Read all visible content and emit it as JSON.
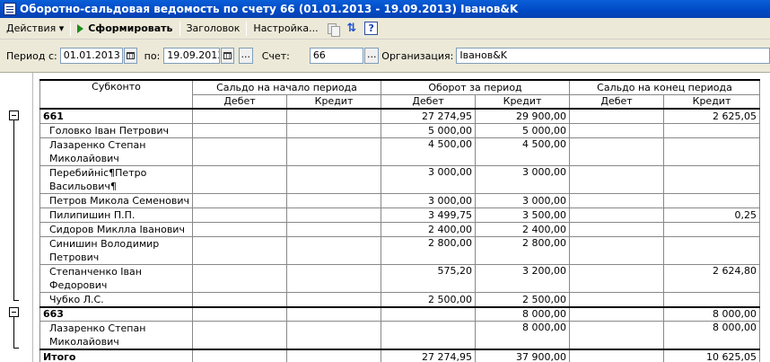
{
  "window": {
    "title": "Оборотно-сальдовая ведомость по счету 66 (01.01.2013 - 19.09.2013) Іванов&K"
  },
  "toolbar": {
    "actions_label": "Действия ▾",
    "generate_label": "Сформировать",
    "header_label": "Заголовок",
    "settings_label": "Настройка...",
    "help_label": "?"
  },
  "filter": {
    "period_from_label": "Период с:",
    "period_from_value": "01.01.2013",
    "period_to_label": "по:",
    "period_to_value": "19.09.2013",
    "account_label": "Счет:",
    "account_value": "66",
    "org_label": "Организация:",
    "org_value": "Іванов&K",
    "dots": "..."
  },
  "report": {
    "headers": {
      "subconto": "Субконто",
      "opening": "Сальдо на начало периода",
      "turnover": "Оборот за период",
      "closing": "Сальдо на конец периода",
      "debit": "Дебет",
      "credit": "Кредит"
    },
    "rows": [
      {
        "type": "group",
        "name": "661",
        "od": "",
        "oc": "",
        "td": "27 274,95",
        "tc": "29 900,00",
        "cd": "",
        "cc": "2 625,05"
      },
      {
        "type": "item",
        "name": "Головко  Іван Петрович",
        "od": "",
        "oc": "",
        "td": "5 000,00",
        "tc": "5 000,00",
        "cd": "",
        "cc": ""
      },
      {
        "type": "item2",
        "name": "Лазаренко Степан Миколайович",
        "od": "",
        "oc": "",
        "td": "4 500,00",
        "tc": "4 500,00",
        "cd": "",
        "cc": ""
      },
      {
        "type": "item2",
        "name": "Перебийніс¶Петро Васильович¶",
        "od": "",
        "oc": "",
        "td": "3 000,00",
        "tc": "3 000,00",
        "cd": "",
        "cc": ""
      },
      {
        "type": "item",
        "name": "Петров Микола Семенович",
        "od": "",
        "oc": "",
        "td": "3 000,00",
        "tc": "3 000,00",
        "cd": "",
        "cc": ""
      },
      {
        "type": "item",
        "name": "Пилипишин П.П.",
        "od": "",
        "oc": "",
        "td": "3 499,75",
        "tc": "3 500,00",
        "cd": "",
        "cc": "0,25"
      },
      {
        "type": "item",
        "name": "Сидоров Миклла Іванович",
        "od": "",
        "oc": "",
        "td": "2 400,00",
        "tc": "2 400,00",
        "cd": "",
        "cc": ""
      },
      {
        "type": "item2",
        "name": "Синишин Володимир Петрович",
        "od": "",
        "oc": "",
        "td": "2 800,00",
        "tc": "2 800,00",
        "cd": "",
        "cc": ""
      },
      {
        "type": "item2",
        "name": "Степанченко Іван Федорович",
        "od": "",
        "oc": "",
        "td": "575,20",
        "tc": "3 200,00",
        "cd": "",
        "cc": "2 624,80"
      },
      {
        "type": "item",
        "name": "Чубко Л.С.",
        "od": "",
        "oc": "",
        "td": "2 500,00",
        "tc": "2 500,00",
        "cd": "",
        "cc": ""
      },
      {
        "type": "group",
        "name": "663",
        "od": "",
        "oc": "",
        "td": "",
        "tc": "8 000,00",
        "cd": "",
        "cc": "8 000,00"
      },
      {
        "type": "item2",
        "name": "Лазаренко Степан Миколайович",
        "od": "",
        "oc": "",
        "td": "",
        "tc": "8 000,00",
        "cd": "",
        "cc": "8 000,00"
      },
      {
        "type": "total",
        "name": "Итого",
        "od": "",
        "oc": "",
        "td": "27 274,95",
        "tc": "37 900,00",
        "cd": "",
        "cc": "10 625,05"
      }
    ]
  }
}
